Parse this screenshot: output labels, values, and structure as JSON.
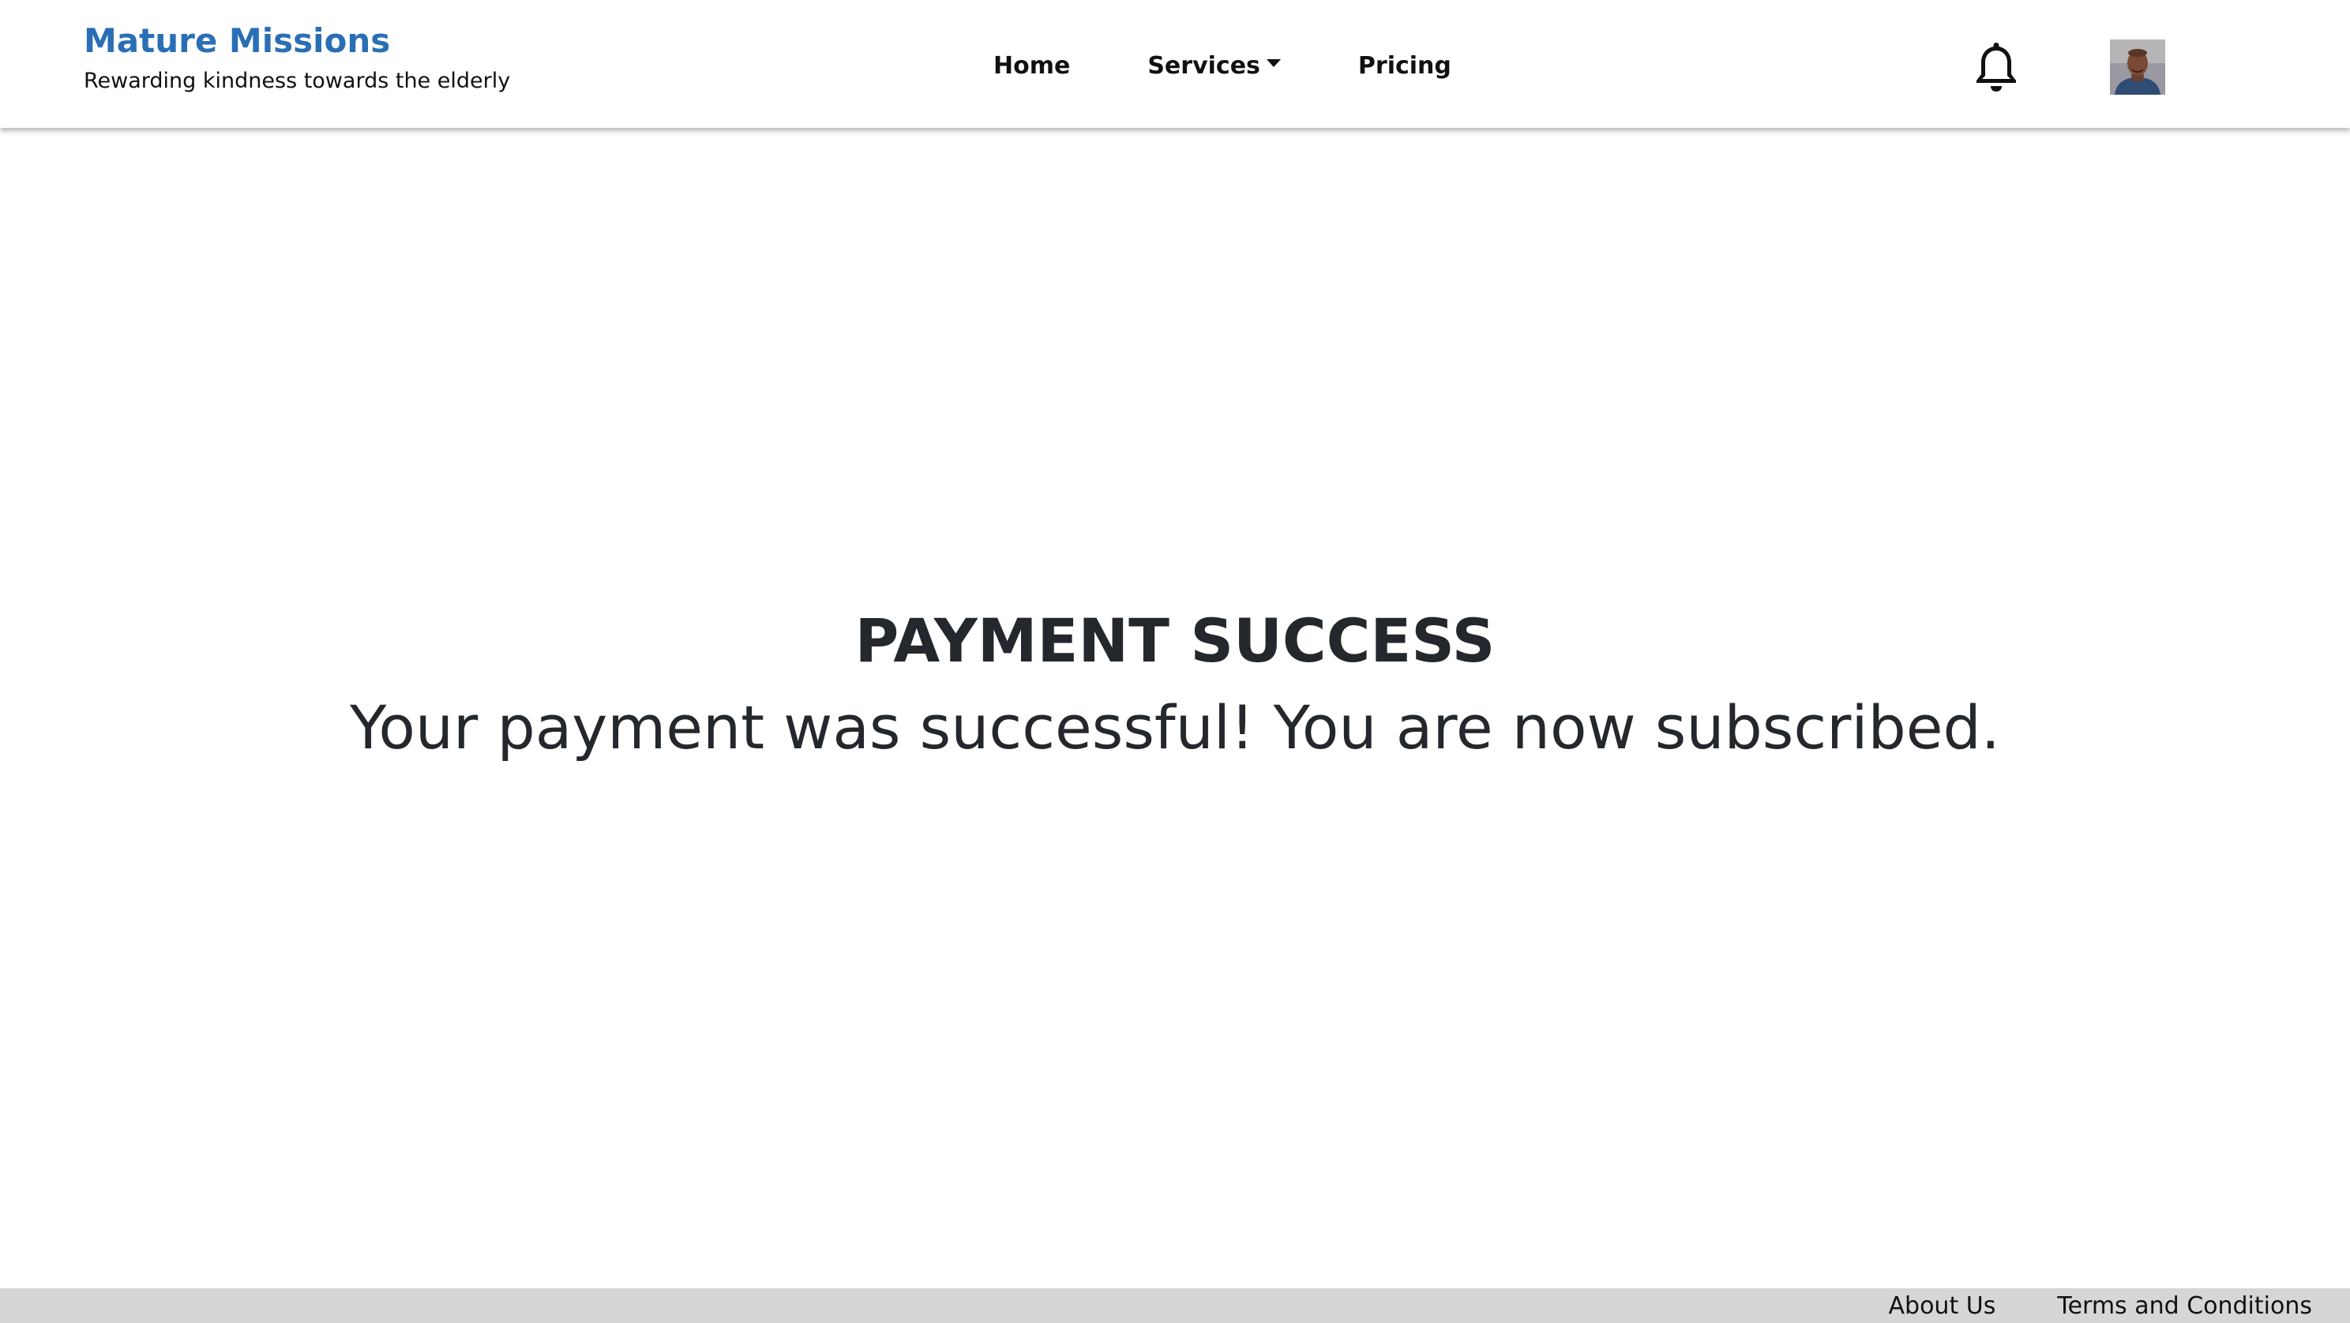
{
  "brand": {
    "title": "Mature Missions",
    "subtitle": "Rewarding kindness towards the elderly",
    "color": "#2a6fb5"
  },
  "nav": {
    "home_label": "Home",
    "services_label": "Services",
    "pricing_label": "Pricing"
  },
  "header_icons": {
    "notifications": "bell-icon",
    "profile": "user-avatar"
  },
  "main": {
    "title": "PAYMENT SUCCESS",
    "message": "Your payment was successful! You are now subscribed."
  },
  "footer": {
    "about_label": "About Us",
    "terms_label": "Terms and Conditions",
    "background": "#d6d6d6"
  }
}
